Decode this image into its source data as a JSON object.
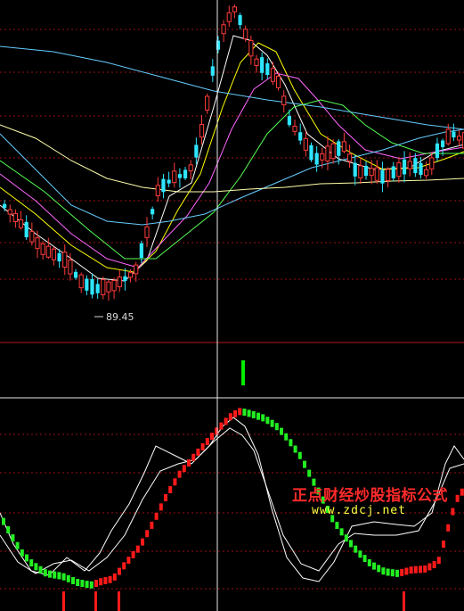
{
  "chart_data": [
    {
      "type": "candlestick",
      "panel": "price",
      "low_annotation": "89.45",
      "up_color": "#ff3b3b",
      "down_color": "#2ee6ff",
      "moving_averages": [
        {
          "color": "#ffffff"
        },
        {
          "color": "#ffff00"
        },
        {
          "color": "#ff66ff"
        },
        {
          "color": "#55ff55"
        },
        {
          "color": "#66ccff"
        },
        {
          "color": "#ffffaa"
        }
      ],
      "grid": "dotted-horizontal",
      "crosshair": true
    },
    {
      "type": "signal",
      "panel": "signal",
      "signal_color": "#00ee00"
    },
    {
      "type": "line",
      "panel": "oscillator",
      "line_color": "#ffffff",
      "rising_color": "#ff1a1a",
      "falling_color": "#22ee22",
      "bottom_signal_color": "#ff1a1a"
    }
  ],
  "watermark": {
    "title": "正点财经炒股指标公式",
    "url": "www.zdcj.net"
  }
}
